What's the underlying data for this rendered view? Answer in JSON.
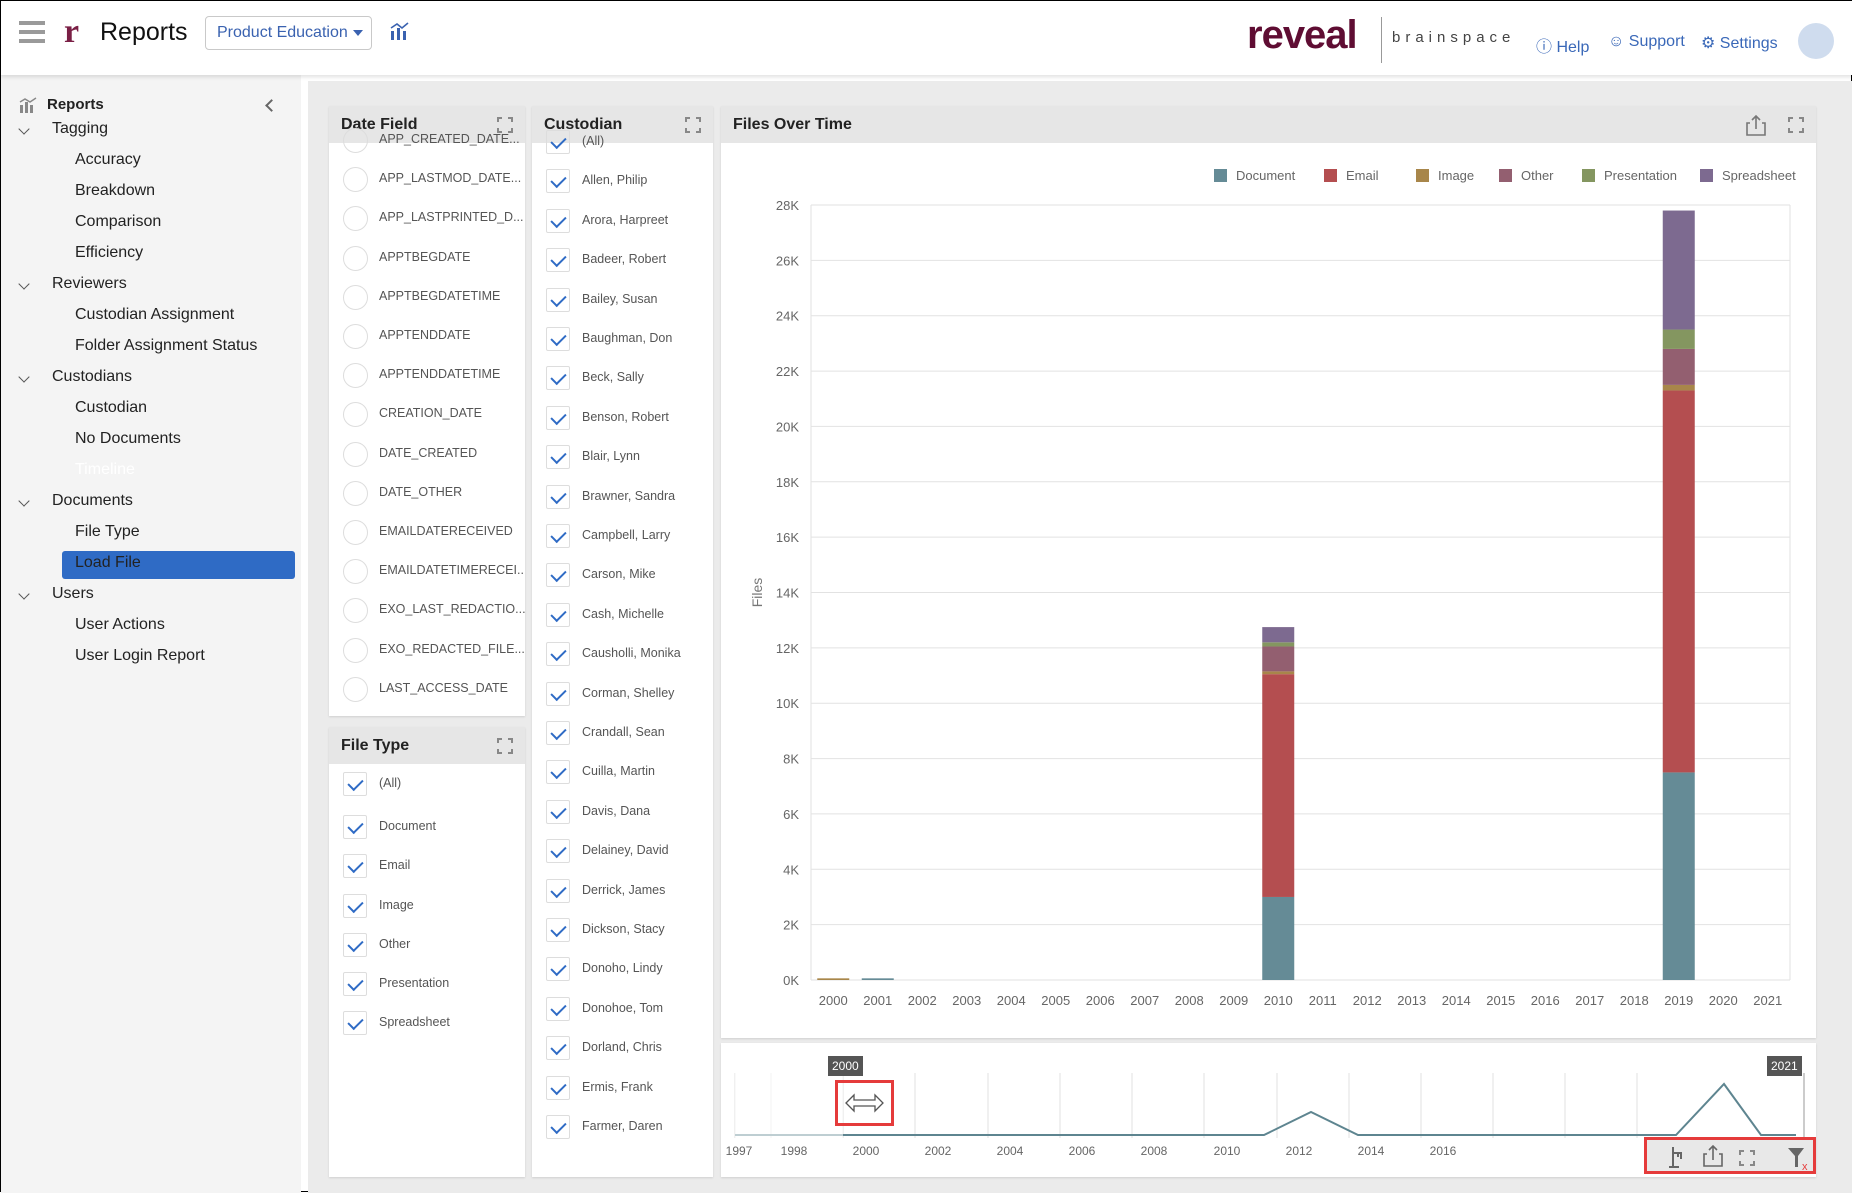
{
  "header": {
    "app_title": "Reports",
    "project_dropdown": "Product Education",
    "logo": "reveal",
    "logo_sub": "brainspace",
    "help": "Help",
    "support": "Support",
    "settings": "Settings"
  },
  "sidebar": {
    "title": "Reports",
    "groups": [
      {
        "label": "Tagging",
        "items": [
          "Accuracy",
          "Breakdown",
          "Comparison",
          "Efficiency"
        ]
      },
      {
        "label": "Reviewers",
        "items": [
          "Custodian Assignment",
          "Folder Assignment Status"
        ]
      },
      {
        "label": "Custodians",
        "items": [
          "Custodian",
          "No Documents",
          "Timeline"
        ]
      },
      {
        "label": "Documents",
        "items": [
          "File Type",
          "Load File"
        ]
      },
      {
        "label": "Users",
        "items": [
          "User Actions",
          "User Login Report"
        ]
      }
    ],
    "selected": "Timeline",
    "selected_color": "#2f6bc5"
  },
  "date_field": {
    "title": "Date Field",
    "items": [
      "APP_CREATED_DATE...",
      "APP_LASTMOD_DATE...",
      "APP_LASTPRINTED_D...",
      "APPTBEGDATE",
      "APPTBEGDATETIME",
      "APPTENDDATE",
      "APPTENDDATETIME",
      "CREATION_DATE",
      "DATE_CREATED",
      "DATE_OTHER",
      "EMAILDATERECEIVED",
      "EMAILDATETIMERECEI...",
      "EXO_LAST_REDACTIO...",
      "EXO_REDACTED_FILE...",
      "LAST_ACCESS_DATE"
    ]
  },
  "file_type": {
    "title": "File Type",
    "items": [
      "(All)",
      "Document",
      "Email",
      "Image",
      "Other",
      "Presentation",
      "Spreadsheet"
    ]
  },
  "custodian": {
    "title": "Custodian",
    "items": [
      "(All)",
      "Allen, Philip",
      "Arora, Harpreet",
      "Badeer, Robert",
      "Bailey, Susan",
      "Baughman, Don",
      "Beck, Sally",
      "Benson, Robert",
      "Blair, Lynn",
      "Brawner, Sandra",
      "Campbell, Larry",
      "Carson, Mike",
      "Cash, Michelle",
      "Causholli, Monika",
      "Corman, Shelley",
      "Crandall, Sean",
      "Cuilla, Martin",
      "Davis, Dana",
      "Delainey, David",
      "Derrick, James",
      "Dickson, Stacy",
      "Donoho, Lindy",
      "Donohoe, Tom",
      "Dorland, Chris",
      "Ermis, Frank",
      "Farmer, Daren"
    ]
  },
  "chart_panel": {
    "title": "Files Over Time"
  },
  "chart_data": {
    "type": "bar",
    "stacked": true,
    "title": "",
    "xlabel": "",
    "ylabel": "Files",
    "ylim": [
      0,
      28000
    ],
    "yticks": [
      "0K",
      "2K",
      "4K",
      "6K",
      "8K",
      "10K",
      "12K",
      "14K",
      "16K",
      "18K",
      "20K",
      "22K",
      "24K",
      "26K",
      "28K"
    ],
    "categories": [
      "2000",
      "2001",
      "2002",
      "2003",
      "2004",
      "2005",
      "2006",
      "2007",
      "2008",
      "2009",
      "2010",
      "2011",
      "2012",
      "2013",
      "2014",
      "2015",
      "2016",
      "2017",
      "2018",
      "2019",
      "2020",
      "2021"
    ],
    "legend": "top-right",
    "grid": true,
    "series": [
      {
        "name": "Document",
        "color": "#658b96",
        "values": [
          0,
          60,
          0,
          0,
          0,
          0,
          0,
          0,
          0,
          0,
          3000,
          0,
          0,
          0,
          0,
          0,
          0,
          0,
          0,
          7500,
          0,
          0
        ]
      },
      {
        "name": "Email",
        "color": "#b44e50",
        "values": [
          0,
          0,
          0,
          0,
          0,
          0,
          0,
          0,
          0,
          0,
          8050,
          0,
          0,
          0,
          0,
          0,
          0,
          0,
          0,
          13800,
          0,
          0
        ]
      },
      {
        "name": "Image",
        "color": "#a8864a",
        "values": [
          60,
          0,
          0,
          0,
          0,
          0,
          0,
          0,
          0,
          0,
          100,
          0,
          0,
          0,
          0,
          0,
          0,
          0,
          0,
          200,
          0,
          0
        ]
      },
      {
        "name": "Other",
        "color": "#935f70",
        "values": [
          0,
          0,
          0,
          0,
          0,
          0,
          0,
          0,
          0,
          0,
          900,
          0,
          0,
          0,
          0,
          0,
          0,
          0,
          0,
          1300,
          0,
          0
        ]
      },
      {
        "name": "Presentation",
        "color": "#849660",
        "values": [
          0,
          0,
          0,
          0,
          0,
          0,
          0,
          0,
          0,
          0,
          150,
          0,
          0,
          0,
          0,
          0,
          0,
          0,
          0,
          700,
          0,
          0
        ]
      },
      {
        "name": "Spreadsheet",
        "color": "#7d6a90",
        "values": [
          0,
          0,
          0,
          0,
          0,
          0,
          0,
          0,
          0,
          0,
          550,
          0,
          0,
          0,
          0,
          0,
          0,
          0,
          0,
          4300,
          0,
          0
        ]
      }
    ]
  },
  "timeline": {
    "axis_labels": [
      "1997",
      "1998",
      "2000",
      "2002",
      "2004",
      "2006",
      "2008",
      "2010",
      "2012",
      "2014",
      "2016"
    ],
    "range_start": "2000",
    "range_end": "2021",
    "line_color": "#5e8590"
  }
}
